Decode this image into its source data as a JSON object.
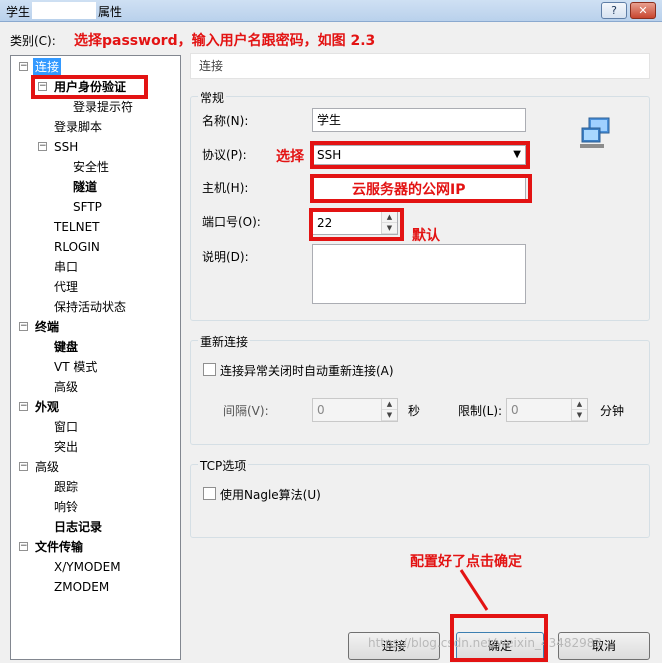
{
  "window": {
    "title_prefix": "学生",
    "title_suffix": "属性",
    "help_glyph": "?",
    "close_glyph": "✕"
  },
  "category_label": "类别(C):",
  "tree": {
    "items": [
      {
        "label": "连接",
        "expander": "⊟",
        "selected": true
      },
      {
        "label": "用户身份验证",
        "expander": "⊟",
        "bold": true
      },
      {
        "label": "登录提示符"
      },
      {
        "label": "登录脚本"
      },
      {
        "label": "SSH",
        "expander": "⊟"
      },
      {
        "label": "安全性"
      },
      {
        "label": "隧道",
        "bold": true
      },
      {
        "label": "SFTP"
      },
      {
        "label": "TELNET"
      },
      {
        "label": "RLOGIN"
      },
      {
        "label": "串口"
      },
      {
        "label": "代理"
      },
      {
        "label": "保持活动状态"
      },
      {
        "label": "终端",
        "expander": "⊟",
        "bold": true
      },
      {
        "label": "键盘",
        "bold": true
      },
      {
        "label": "VT 模式"
      },
      {
        "label": "高级"
      },
      {
        "label": "外观",
        "expander": "⊟",
        "bold": true
      },
      {
        "label": "窗口"
      },
      {
        "label": "突出"
      },
      {
        "label": "高级",
        "expander": "⊟"
      },
      {
        "label": "跟踪"
      },
      {
        "label": "响铃"
      },
      {
        "label": "日志记录",
        "bold": true
      },
      {
        "label": "文件传输",
        "expander": "⊟",
        "bold": true
      },
      {
        "label": "X/YMODEM"
      },
      {
        "label": "ZMODEM"
      }
    ]
  },
  "section_header": "连接",
  "general": {
    "title": "常规",
    "name_label": "名称(N):",
    "name_value": "学生",
    "protocol_label": "协议(P):",
    "protocol_value": "SSH",
    "host_label": "主机(H):",
    "host_value": "",
    "port_label": "端口号(O):",
    "port_value": "22",
    "desc_label": "说明(D):",
    "desc_value": ""
  },
  "reconnect": {
    "title": "重新连接",
    "checkbox_label": "连接异常关闭时自动重新连接(A)",
    "interval_label": "间隔(V):",
    "interval_value": "0",
    "interval_unit": "秒",
    "limit_label": "限制(L):",
    "limit_value": "0",
    "limit_unit": "分钟"
  },
  "tcp": {
    "title": "TCP选项",
    "nagle_label": "使用Nagle算法(U)"
  },
  "buttons": {
    "connect": "连接",
    "ok": "确定",
    "cancel": "取消"
  },
  "annotations": {
    "top": "选择password，输入用户名跟密码，如图 2.3",
    "select": "选择",
    "host": "云服务器的公网IP",
    "default": "默认",
    "confirm": "配置好了点击确定"
  },
  "watermark": "https://blog.csdn.net/weixin_43482983",
  "colors": {
    "annotation_red": "#e31313",
    "selection_blue": "#3399ff"
  }
}
